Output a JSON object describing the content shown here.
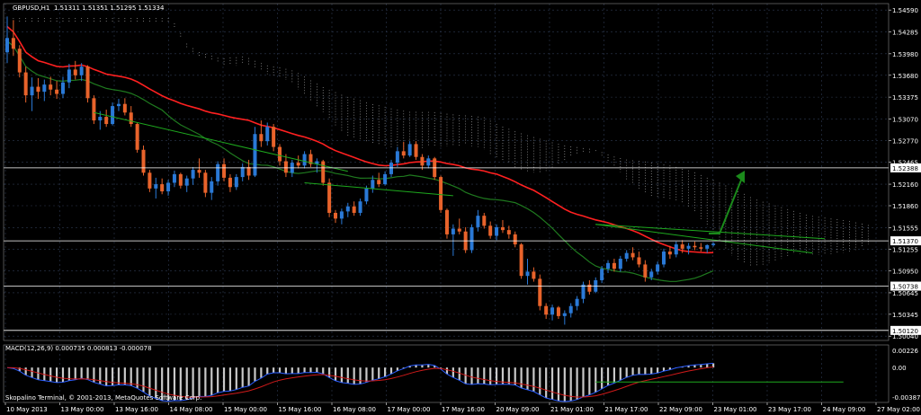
{
  "header": {
    "symbol_text": "GBPUSD,H1",
    "ohlc_text": "1.51311 1.51351 1.51295 1.51334"
  },
  "macd": {
    "label": "MACD(12,26,9) 0.000735 0.000813 -0.000078",
    "ticks": [
      "0.00226",
      "0.00",
      "-0.00387"
    ]
  },
  "footer": {
    "copyright": "Skopalino Terminal, © 2001-2013, MetaQuotes Software Corp."
  },
  "chart_data": {
    "type": "candlestick",
    "symbol": "GBPUSD",
    "timeframe": "H1",
    "ohlc": {
      "open": 1.51311,
      "high": 1.51351,
      "low": 1.51295,
      "close": 1.51334
    },
    "x_labels": [
      "10 May 2013",
      "13 May 00:00",
      "13 May 16:00",
      "14 May 08:00",
      "15 May 00:00",
      "15 May 16:00",
      "16 May 08:00",
      "17 May 00:00",
      "17 May 16:00",
      "20 May 09:00",
      "21 May 01:00",
      "21 May 17:00",
      "22 May 09:00",
      "23 May 01:00",
      "23 May 17:00",
      "24 May 09:00",
      "27 May 02:00"
    ],
    "y_ticks": [
      1.5459,
      1.54285,
      1.5398,
      1.5368,
      1.53375,
      1.5307,
      1.5277,
      1.52465,
      1.5216,
      1.5186,
      1.51555,
      1.51255,
      1.5095,
      1.50645,
      1.50345,
      1.5004
    ],
    "y_tick_labels": [
      "1.54590",
      "1.54285",
      "1.53980",
      "1.53680",
      "1.53375",
      "1.53070",
      "1.52770",
      "1.52465",
      "1.52160",
      "1.51860",
      "1.51555",
      "1.51255",
      "1.50950",
      "1.50645",
      "1.50345",
      "1.50040"
    ],
    "ylim": [
      1.4998,
      1.5468
    ],
    "horizontal_levels": [
      {
        "value": 1.52388,
        "label": "1.52388"
      },
      {
        "value": 1.5137,
        "label": "1.51370"
      },
      {
        "value": 1.50738,
        "label": "1.50738"
      },
      {
        "value": 1.5012,
        "label": "1.50120"
      }
    ],
    "candles_n": 220,
    "candles": [
      [
        1.54,
        1.545,
        1.5385,
        1.542
      ],
      [
        1.542,
        1.5445,
        1.5395,
        1.5405
      ],
      [
        1.5405,
        1.541,
        1.5365,
        1.5372
      ],
      [
        1.5372,
        1.538,
        1.533,
        1.534
      ],
      [
        1.534,
        1.5365,
        1.5318,
        1.5352
      ],
      [
        1.5352,
        1.5364,
        1.5335,
        1.5345
      ],
      [
        1.5345,
        1.5362,
        1.5332,
        1.5355
      ],
      [
        1.5355,
        1.5366,
        1.534,
        1.5348
      ],
      [
        1.5348,
        1.536,
        1.5335,
        1.5342
      ],
      [
        1.5342,
        1.5366,
        1.5336,
        1.5358
      ],
      [
        1.5358,
        1.5384,
        1.535,
        1.5376
      ],
      [
        1.5376,
        1.5388,
        1.5362,
        1.5368
      ],
      [
        1.5368,
        1.5385,
        1.536,
        1.538
      ],
      [
        1.538,
        1.5382,
        1.533,
        1.5336
      ],
      [
        1.5336,
        1.534,
        1.53,
        1.5305
      ],
      [
        1.5305,
        1.5318,
        1.5292,
        1.531
      ],
      [
        1.531,
        1.532,
        1.5296,
        1.53
      ],
      [
        1.53,
        1.533,
        1.5298,
        1.5325
      ],
      [
        1.5325,
        1.5335,
        1.5318,
        1.5328
      ],
      [
        1.5328,
        1.5336,
        1.5312,
        1.5316
      ],
      [
        1.5316,
        1.5325,
        1.5296,
        1.53
      ],
      [
        1.53,
        1.5302,
        1.526,
        1.5264
      ],
      [
        1.5264,
        1.527,
        1.5228,
        1.5232
      ],
      [
        1.5232,
        1.5236,
        1.5205,
        1.521
      ],
      [
        1.521,
        1.5225,
        1.5196,
        1.5216
      ],
      [
        1.5216,
        1.5224,
        1.5202,
        1.5206
      ],
      [
        1.5206,
        1.5222,
        1.52,
        1.5218
      ],
      [
        1.5218,
        1.5235,
        1.5212,
        1.523
      ],
      [
        1.523,
        1.5232,
        1.521,
        1.5214
      ],
      [
        1.5214,
        1.5228,
        1.5205,
        1.5224
      ],
      [
        1.5224,
        1.524,
        1.5215,
        1.5236
      ],
      [
        1.5236,
        1.5252,
        1.5225,
        1.5232
      ],
      [
        1.5232,
        1.5236,
        1.5198,
        1.5204
      ],
      [
        1.5204,
        1.5226,
        1.5194,
        1.522
      ],
      [
        1.522,
        1.5248,
        1.5214,
        1.5244
      ],
      [
        1.5244,
        1.5252,
        1.522,
        1.5225
      ],
      [
        1.5225,
        1.523,
        1.5205,
        1.5212
      ],
      [
        1.5212,
        1.523,
        1.5208,
        1.5226
      ],
      [
        1.5226,
        1.5245,
        1.522,
        1.524
      ],
      [
        1.524,
        1.525,
        1.5222,
        1.5228
      ],
      [
        1.5228,
        1.5296,
        1.5226,
        1.5286
      ],
      [
        1.5286,
        1.5305,
        1.5268,
        1.5276
      ],
      [
        1.5276,
        1.5302,
        1.527,
        1.5296
      ],
      [
        1.5296,
        1.53,
        1.5262,
        1.5268
      ],
      [
        1.5268,
        1.5272,
        1.5242,
        1.5248
      ],
      [
        1.5248,
        1.5258,
        1.5226,
        1.5232
      ],
      [
        1.5232,
        1.525,
        1.5226,
        1.5246
      ],
      [
        1.5246,
        1.5256,
        1.5238,
        1.5242
      ],
      [
        1.5242,
        1.5262,
        1.5238,
        1.5258
      ],
      [
        1.5258,
        1.5264,
        1.524,
        1.5244
      ],
      [
        1.5244,
        1.5252,
        1.5232,
        1.5248
      ],
      [
        1.5248,
        1.525,
        1.5214,
        1.5218
      ],
      [
        1.5218,
        1.5224,
        1.517,
        1.5176
      ],
      [
        1.5176,
        1.518,
        1.5162,
        1.5168
      ],
      [
        1.5168,
        1.5182,
        1.516,
        1.5178
      ],
      [
        1.5178,
        1.519,
        1.517,
        1.5185
      ],
      [
        1.5185,
        1.5192,
        1.5172,
        1.5176
      ],
      [
        1.5176,
        1.5196,
        1.5172,
        1.5192
      ],
      [
        1.5192,
        1.5214,
        1.5188,
        1.521
      ],
      [
        1.521,
        1.5228,
        1.5204,
        1.5222
      ],
      [
        1.5222,
        1.5232,
        1.5212,
        1.5216
      ],
      [
        1.5216,
        1.5234,
        1.5214,
        1.523
      ],
      [
        1.523,
        1.525,
        1.5226,
        1.5246
      ],
      [
        1.5246,
        1.5268,
        1.524,
        1.5262
      ],
      [
        1.5262,
        1.5275,
        1.5252,
        1.5256
      ],
      [
        1.5256,
        1.5276,
        1.5254,
        1.5272
      ],
      [
        1.5272,
        1.5276,
        1.525,
        1.5254
      ],
      [
        1.5254,
        1.5258,
        1.5236,
        1.5242
      ],
      [
        1.5242,
        1.5256,
        1.5238,
        1.5252
      ],
      [
        1.5252,
        1.5254,
        1.5222,
        1.5226
      ],
      [
        1.5226,
        1.5228,
        1.5176,
        1.518
      ],
      [
        1.518,
        1.5182,
        1.514,
        1.5146
      ],
      [
        1.5146,
        1.516,
        1.5116,
        1.5154
      ],
      [
        1.5154,
        1.5168,
        1.5146,
        1.515
      ],
      [
        1.515,
        1.5156,
        1.512,
        1.5124
      ],
      [
        1.5124,
        1.516,
        1.512,
        1.5156
      ],
      [
        1.5156,
        1.518,
        1.515,
        1.5172
      ],
      [
        1.5172,
        1.5176,
        1.5154,
        1.5158
      ],
      [
        1.5158,
        1.5164,
        1.514,
        1.5144
      ],
      [
        1.5144,
        1.516,
        1.5138,
        1.5156
      ],
      [
        1.5156,
        1.5166,
        1.5148,
        1.5152
      ],
      [
        1.5152,
        1.5158,
        1.514,
        1.5146
      ],
      [
        1.5146,
        1.515,
        1.5128,
        1.5132
      ],
      [
        1.5132,
        1.5134,
        1.5084,
        1.5088
      ],
      [
        1.5088,
        1.5112,
        1.5076,
        1.5094
      ],
      [
        1.5094,
        1.51,
        1.508,
        1.5084
      ],
      [
        1.5084,
        1.509,
        1.504,
        1.5046
      ],
      [
        1.5046,
        1.505,
        1.5028,
        1.5034
      ],
      [
        1.5034,
        1.5048,
        1.5026,
        1.5044
      ],
      [
        1.5044,
        1.5046,
        1.5028,
        1.5032
      ],
      [
        1.5032,
        1.504,
        1.502,
        1.5036
      ],
      [
        1.5036,
        1.505,
        1.503,
        1.5046
      ],
      [
        1.5046,
        1.506,
        1.504,
        1.5056
      ],
      [
        1.5056,
        1.508,
        1.505,
        1.5076
      ],
      [
        1.5076,
        1.5082,
        1.5062,
        1.5066
      ],
      [
        1.5066,
        1.5086,
        1.5064,
        1.5082
      ],
      [
        1.5082,
        1.5102,
        1.5078,
        1.5098
      ],
      [
        1.5098,
        1.511,
        1.5092,
        1.5106
      ],
      [
        1.5106,
        1.5112,
        1.5094,
        1.5098
      ],
      [
        1.5098,
        1.5116,
        1.5094,
        1.5112
      ],
      [
        1.5112,
        1.5124,
        1.5108,
        1.512
      ],
      [
        1.512,
        1.5128,
        1.511,
        1.5114
      ],
      [
        1.5114,
        1.5122,
        1.51,
        1.5104
      ],
      [
        1.5104,
        1.511,
        1.508,
        1.5086
      ],
      [
        1.5086,
        1.5098,
        1.5082,
        1.5094
      ],
      [
        1.5094,
        1.5108,
        1.509,
        1.5104
      ],
      [
        1.5104,
        1.5126,
        1.51,
        1.5122
      ],
      [
        1.5122,
        1.513,
        1.5112,
        1.5118
      ],
      [
        1.5118,
        1.5136,
        1.5114,
        1.5132
      ],
      [
        1.5132,
        1.5138,
        1.512,
        1.5126
      ],
      [
        1.5126,
        1.5134,
        1.5118,
        1.513
      ],
      [
        1.513,
        1.5136,
        1.5124,
        1.5128
      ],
      [
        1.5128,
        1.5134,
        1.5122,
        1.5126
      ],
      [
        1.5126,
        1.5132,
        1.512,
        1.5131
      ],
      [
        1.5131,
        1.5135,
        1.5129,
        1.5133
      ]
    ],
    "series": [
      {
        "kind": "line",
        "values_y": [],
        "color": "#e21a1a"
      }
    ],
    "overlays": {
      "moving_average_red": {
        "color": "#ff2020"
      },
      "moving_average_green": {
        "color": "#1f7a1f"
      },
      "ichimoku_cloud_up": {
        "color": "#f3a66b"
      },
      "ichimoku_cloud_down": {
        "color": "#d8d8d8"
      },
      "trend_line_color": "#1ea91e",
      "arrow_color": "#1b8a1b"
    },
    "colors": {
      "background": "#000000",
      "grid": "#2e3a52",
      "bull_candle": "#2a79d6",
      "bear_candle": "#e8632b",
      "axis_text": "#ffffff",
      "macd_line": "#2a5dff",
      "signal_line": "#d01a1a",
      "macd_hist": "#c8c8c8",
      "macd_cross": "#ff2020"
    },
    "macd_ylim": [
      -0.00387,
      0.00226
    ],
    "macd_hist": [],
    "grid": true
  }
}
